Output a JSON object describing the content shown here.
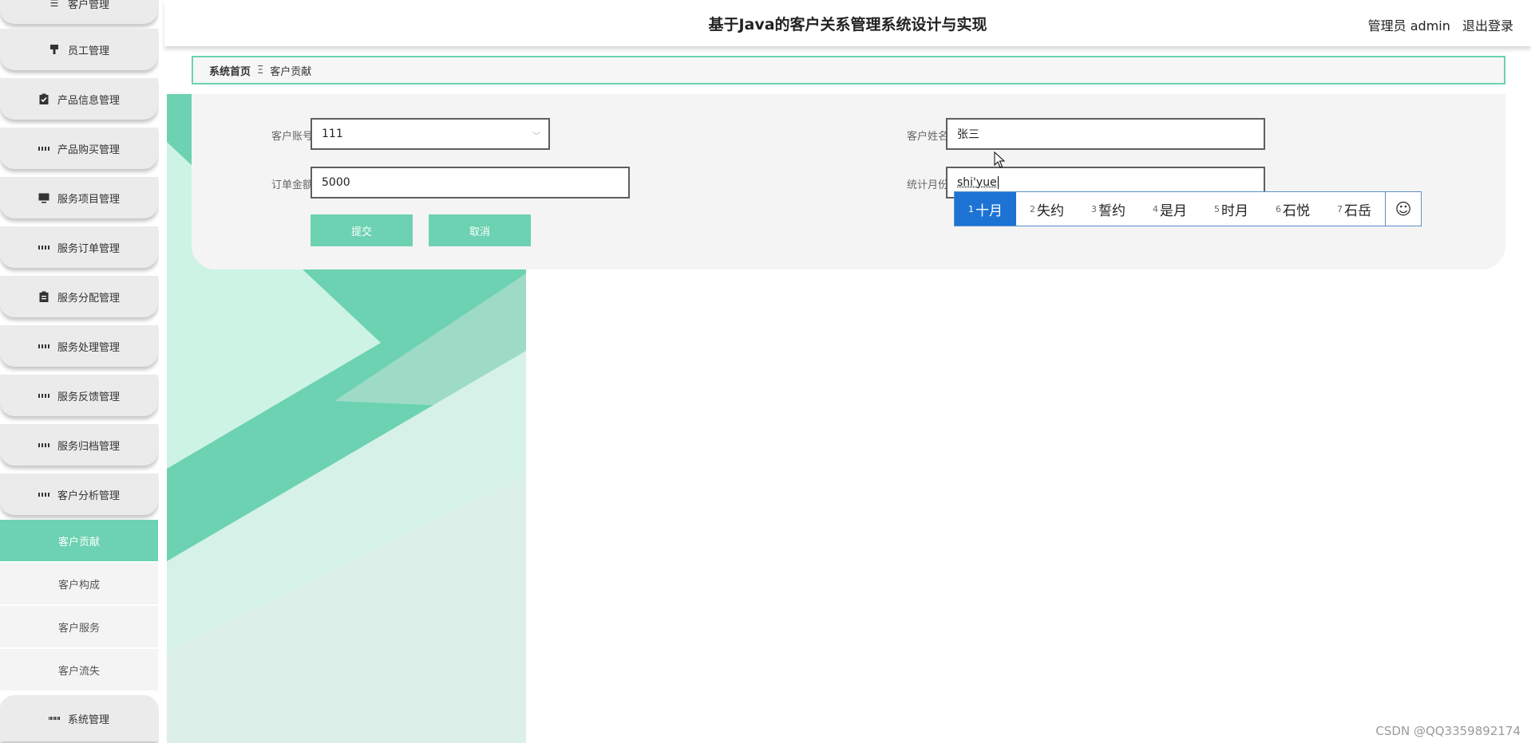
{
  "header": {
    "title": "基于Java的客户关系管理系统设计与实现",
    "user_label": "管理员 admin",
    "logout_label": "退出登录"
  },
  "sidebar": {
    "items": [
      {
        "label": "客户管理",
        "icon": "list-icon"
      },
      {
        "label": "员工管理",
        "icon": "user-icon"
      },
      {
        "label": "产品信息管理",
        "icon": "clipboard-check-icon"
      },
      {
        "label": "产品购买管理",
        "icon": "grid-icon"
      },
      {
        "label": "服务项目管理",
        "icon": "monitor-icon"
      },
      {
        "label": "服务订单管理",
        "icon": "grid-icon"
      },
      {
        "label": "服务分配管理",
        "icon": "clipboard-icon"
      },
      {
        "label": "服务处理管理",
        "icon": "grid-icon"
      },
      {
        "label": "服务反馈管理",
        "icon": "grid-icon"
      },
      {
        "label": "服务归档管理",
        "icon": "grid-icon"
      },
      {
        "label": "客户分析管理",
        "icon": "grid-icon"
      }
    ],
    "subitems": [
      {
        "label": "客户贡献",
        "active": true
      },
      {
        "label": "客户构成",
        "active": false
      },
      {
        "label": "客户服务",
        "active": false
      },
      {
        "label": "客户流失",
        "active": false
      }
    ],
    "bottom_item": {
      "label": "系统管理",
      "icon": "apps-grid-icon"
    }
  },
  "breadcrumb": {
    "home": "系统首页",
    "separator": "Ξ",
    "current": "客户贡献"
  },
  "form": {
    "account_label": "客户账号",
    "account_value": "111",
    "name_label": "客户姓名",
    "name_value": "张三",
    "amount_label": "订单金额",
    "amount_value": "5000",
    "month_label": "统计月份",
    "month_value": "shi'yue",
    "submit_label": "提交",
    "cancel_label": "取消"
  },
  "ime": {
    "candidates": [
      {
        "num": "1",
        "text": "十月",
        "selected": true
      },
      {
        "num": "2",
        "text": "失约",
        "selected": false
      },
      {
        "num": "3",
        "text": "誓约",
        "selected": false
      },
      {
        "num": "4",
        "text": "是月",
        "selected": false
      },
      {
        "num": "5",
        "text": "时月",
        "selected": false
      },
      {
        "num": "6",
        "text": "石悦",
        "selected": false
      },
      {
        "num": "7",
        "text": "石岳",
        "selected": false
      }
    ],
    "emoji": "☺"
  },
  "colors": {
    "accent": "#6cd2b1",
    "ime_selected": "#1d73d3"
  },
  "watermark": "CSDN @QQ3359892174"
}
